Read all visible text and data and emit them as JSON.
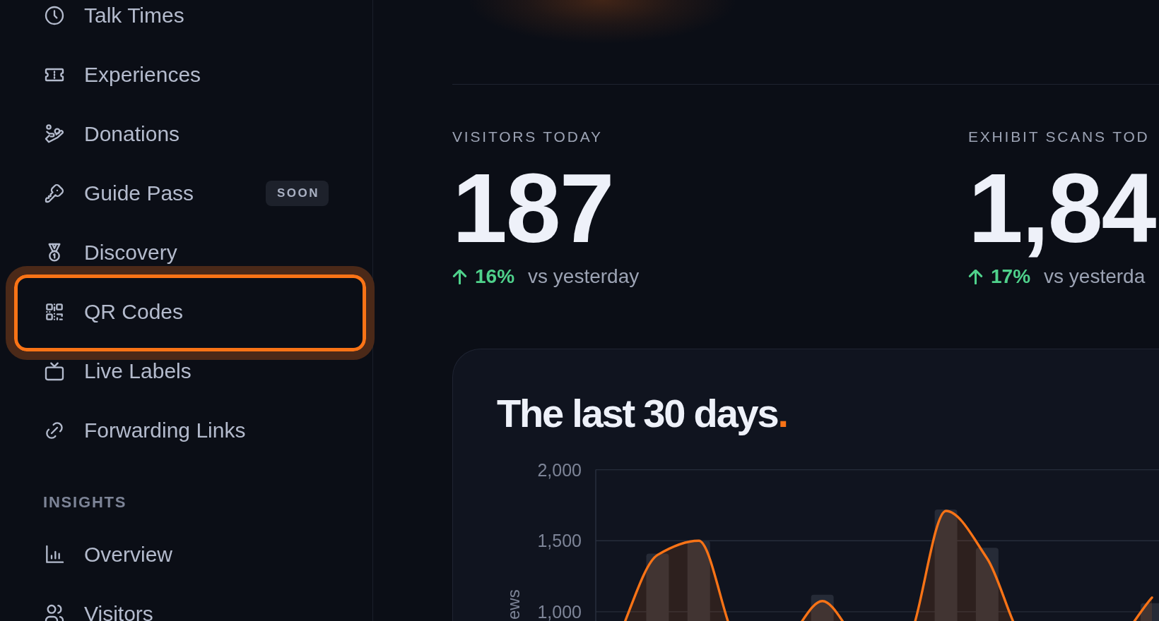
{
  "sidebar": {
    "sections": [
      {
        "items": [
          {
            "label": "Talk Times",
            "selected": false
          },
          {
            "label": "Experiences",
            "selected": false
          },
          {
            "label": "Donations",
            "selected": false
          },
          {
            "label": "Guide Pass",
            "badge": "SOON",
            "selected": false
          },
          {
            "label": "Discovery",
            "selected": false
          },
          {
            "label": "QR Codes",
            "selected": true
          },
          {
            "label": "Live Labels",
            "selected": false
          },
          {
            "label": "Forwarding Links",
            "selected": false
          }
        ]
      },
      {
        "heading": "INSIGHTS",
        "items": [
          {
            "label": "Overview",
            "selected": false
          },
          {
            "label": "Visitors",
            "selected": false
          }
        ]
      }
    ]
  },
  "stats": [
    {
      "label": "VISITORS TODAY",
      "value": "187",
      "rising": true,
      "change": "16%",
      "comparison": "vs yesterday"
    },
    {
      "label": "EXHIBIT SCANS TOD",
      "value": "1,84",
      "rising": true,
      "change": "17%",
      "comparison": "vs yesterda"
    }
  ],
  "chart_card": {
    "heading": "The last 30 days",
    "heading_accent": ".",
    "chart_data": {
      "type": "bar",
      "ylabel": "ews",
      "ylim": [
        935,
        2000
      ],
      "yticks": [
        {
          "value": 1000,
          "label": "1,000"
        },
        {
          "value": 1500,
          "label": "1,500"
        },
        {
          "value": 2000,
          "label": "2,000"
        }
      ],
      "series": [
        {
          "color": "#262b37",
          "values": [
            null,
            1410,
            1500,
            null,
            null,
            1120,
            null,
            null,
            1720,
            1450,
            null,
            null,
            null,
            1060
          ]
        },
        {
          "type": "line",
          "color": "#f97316",
          "values": [
            null,
            1400,
            1500,
            null,
            null,
            1075,
            null,
            null,
            1710,
            1375,
            null,
            null,
            null,
            1100
          ]
        }
      ]
    }
  }
}
